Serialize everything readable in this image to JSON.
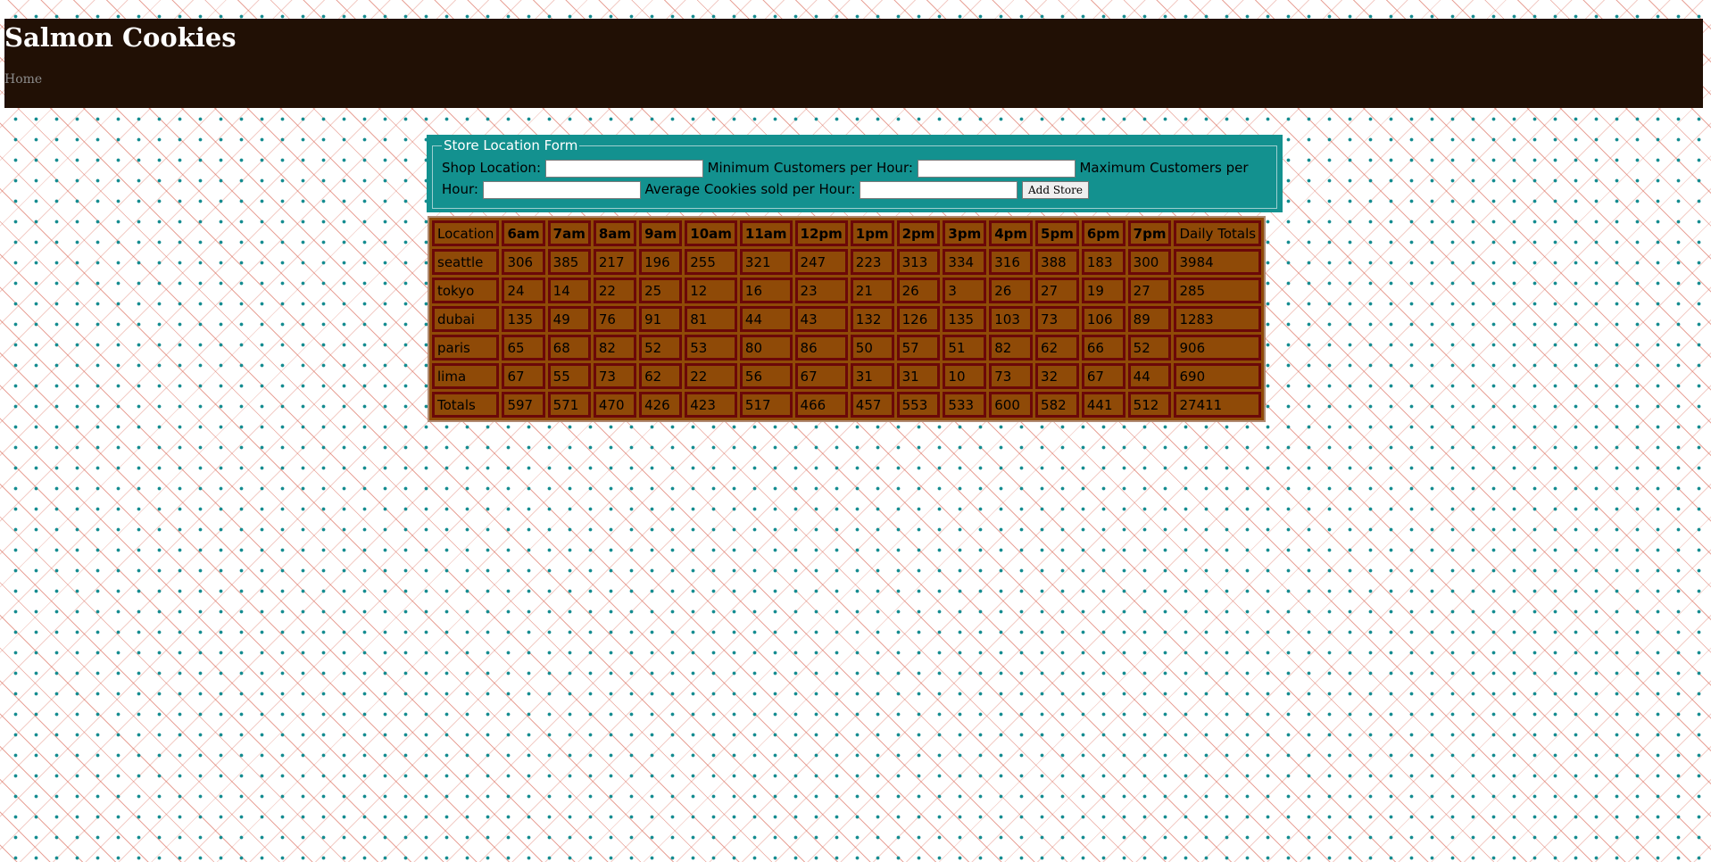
{
  "header": {
    "title": "Salmon Cookies",
    "nav": {
      "home": "Home"
    }
  },
  "form": {
    "legend": "Store Location Form",
    "fields": {
      "location": {
        "label": "Shop Location:",
        "value": ""
      },
      "min_customers": {
        "label": "Minimum Customers per Hour:",
        "value": ""
      },
      "max_customers": {
        "label": "Maximum Customers per Hour:",
        "value": ""
      },
      "avg_cookies": {
        "label": "Average Cookies sold per Hour:",
        "value": ""
      }
    },
    "submit_label": "Add Store"
  },
  "table": {
    "headers": [
      "Location",
      "6am",
      "7am",
      "8am",
      "9am",
      "10am",
      "11am",
      "12pm",
      "1pm",
      "2pm",
      "3pm",
      "4pm",
      "5pm",
      "6pm",
      "7pm",
      "Daily Totals"
    ],
    "rows": [
      [
        "seattle",
        "306",
        "385",
        "217",
        "196",
        "255",
        "321",
        "247",
        "223",
        "313",
        "334",
        "316",
        "388",
        "183",
        "300",
        "3984"
      ],
      [
        "tokyo",
        "24",
        "14",
        "22",
        "25",
        "12",
        "16",
        "23",
        "21",
        "26",
        "3",
        "26",
        "27",
        "19",
        "27",
        "285"
      ],
      [
        "dubai",
        "135",
        "49",
        "76",
        "91",
        "81",
        "44",
        "43",
        "132",
        "126",
        "135",
        "103",
        "73",
        "106",
        "89",
        "1283"
      ],
      [
        "paris",
        "65",
        "68",
        "82",
        "52",
        "53",
        "80",
        "86",
        "50",
        "57",
        "51",
        "82",
        "62",
        "66",
        "52",
        "906"
      ],
      [
        "lima",
        "67",
        "55",
        "73",
        "62",
        "22",
        "56",
        "67",
        "31",
        "31",
        "10",
        "73",
        "32",
        "67",
        "44",
        "690"
      ]
    ],
    "footer": [
      "Totals",
      "597",
      "571",
      "470",
      "426",
      "423",
      "517",
      "466",
      "457",
      "553",
      "533",
      "600",
      "582",
      "441",
      "512",
      "27411"
    ]
  },
  "colors": {
    "header_bg": "#211005",
    "form_bg": "#13918f",
    "table_cell_bg": "#8f4a07",
    "table_border": "#6b0808"
  }
}
